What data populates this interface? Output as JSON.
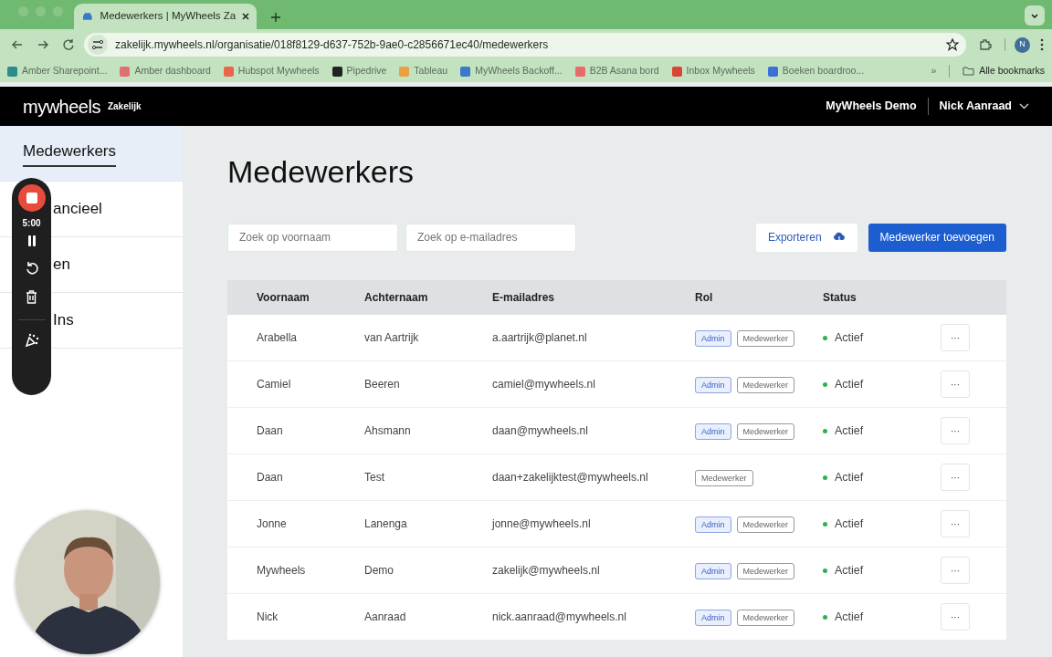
{
  "browser": {
    "tab_title": "Medewerkers | MyWheels Za",
    "url": "zakelijk.mywheels.nl/organisatie/018f8129-d637-752b-9ae0-c2856671ec40/medewerkers",
    "profile_initial": "N",
    "bookmarks": [
      {
        "label": "Amber Sharepoint...",
        "color": "#2e8b8b"
      },
      {
        "label": "Amber dashboard",
        "color": "#e07070"
      },
      {
        "label": "Hubspot Mywheels",
        "color": "#e8664a"
      },
      {
        "label": "Pipedrive",
        "color": "#222222"
      },
      {
        "label": "Tableau",
        "color": "#e8a040"
      },
      {
        "label": "MyWheels Backoff...",
        "color": "#3a78c8"
      },
      {
        "label": "B2B Asana bord",
        "color": "#e86a6a"
      },
      {
        "label": "Inbox Mywheels",
        "color": "#d94636"
      },
      {
        "label": "Boeken boardroo...",
        "color": "#3d6fd6"
      }
    ],
    "more": "»",
    "all_bookmarks": "Alle bookmarks"
  },
  "header": {
    "logo": "mywheels",
    "logo_sub": "Zakelijk",
    "org": "MyWheels Demo",
    "user": "Nick Aanraad"
  },
  "sidebar": {
    "items": [
      {
        "label": "Medewerkers",
        "selected": true
      },
      {
        "label": "ancieel",
        "selected": false
      },
      {
        "label": "en",
        "selected": false
      },
      {
        "label": "Ins",
        "selected": false
      }
    ]
  },
  "recorder": {
    "time": "5:00"
  },
  "page": {
    "title": "Medewerkers",
    "search_first_name": {
      "placeholder": "Zoek op voornaam"
    },
    "search_email": {
      "placeholder": "Zoek op e-mailadres"
    },
    "export_button": "Exporteren",
    "add_button": "Medewerker toevoegen"
  },
  "table": {
    "columns": [
      "Voornaam",
      "Achternaam",
      "E-mailadres",
      "Rol",
      "Status"
    ],
    "rows": [
      {
        "first": "Arabella",
        "last": "van Aartrijk",
        "email": "a.aartrijk@planet.nl",
        "roles": [
          {
            "label": "Admin",
            "kind": "admin"
          },
          {
            "label": "Medewerker",
            "kind": "employee"
          }
        ],
        "status": "Actief",
        "color": "#2bb34a",
        "menu": "···"
      },
      {
        "first": "Camiel",
        "last": "Beeren",
        "email": "camiel@mywheels.nl",
        "roles": [
          {
            "label": "Admin",
            "kind": "admin"
          },
          {
            "label": "Medewerker",
            "kind": "employee"
          }
        ],
        "status": "Actief",
        "color": "#2bb34a",
        "menu": "···"
      },
      {
        "first": "Daan",
        "last": "Ahsmann",
        "email": "daan@mywheels.nl",
        "roles": [
          {
            "label": "Admin",
            "kind": "admin"
          },
          {
            "label": "Medewerker",
            "kind": "employee"
          }
        ],
        "status": "Actief",
        "color": "#2bb34a",
        "menu": "···"
      },
      {
        "first": "Daan",
        "last": "Test",
        "email": "daan+zakelijktest@mywheels.nl",
        "roles": [
          {
            "label": "Medewerker",
            "kind": "employee"
          }
        ],
        "status": "Actief",
        "color": "#2bb34a",
        "menu": "···"
      },
      {
        "first": "Jonne",
        "last": "Lanenga",
        "email": "jonne@mywheels.nl",
        "roles": [
          {
            "label": "Admin",
            "kind": "admin"
          },
          {
            "label": "Medewerker",
            "kind": "employee"
          }
        ],
        "status": "Actief",
        "color": "#2bb34a",
        "menu": "···"
      },
      {
        "first": "Mywheels",
        "last": "Demo",
        "email": "zakelijk@mywheels.nl",
        "roles": [
          {
            "label": "Admin",
            "kind": "admin"
          },
          {
            "label": "Medewerker",
            "kind": "employee"
          }
        ],
        "status": "Actief",
        "color": "#2bb34a",
        "menu": "···"
      },
      {
        "first": "Nick",
        "last": "Aanraad",
        "email": "nick.aanraad@mywheels.nl",
        "roles": [
          {
            "label": "Admin",
            "kind": "admin"
          },
          {
            "label": "Medewerker",
            "kind": "employee"
          }
        ],
        "status": "Actief",
        "color": "#2bb34a",
        "menu": "···"
      }
    ]
  }
}
